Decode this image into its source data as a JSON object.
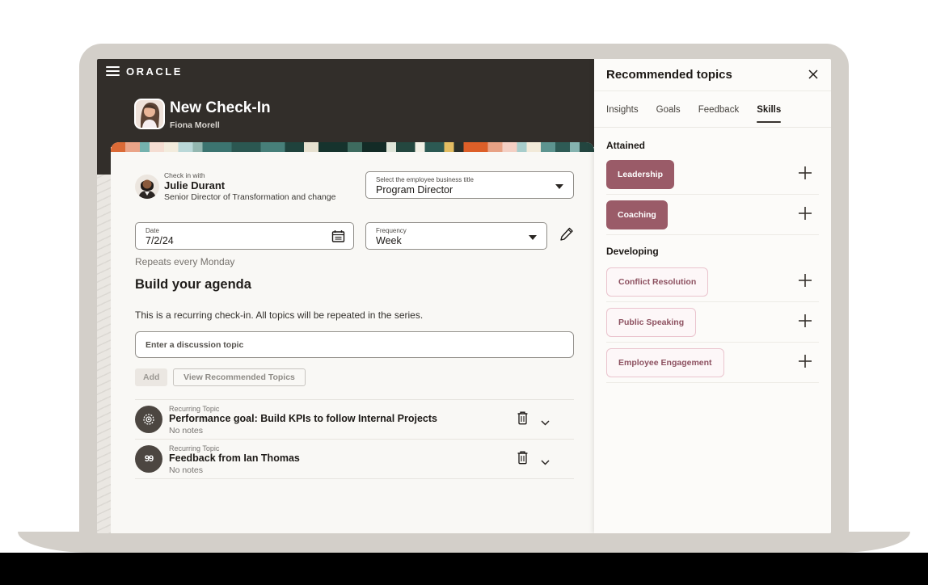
{
  "brand": {
    "logo": "ORACLE"
  },
  "header": {
    "title": "New Check-In",
    "subtitle": "Fiona Morell"
  },
  "checkin": {
    "with_label": "Check in with",
    "person_name": "Julie Durant",
    "person_title": "Senior Director of Transformation and change",
    "business_title_label": "Select the employee business title",
    "business_title_value": "Program Director",
    "date_label": "Date",
    "date_value": "7/2/24",
    "frequency_label": "Frequency",
    "frequency_value": "Week",
    "repeats_text": "Repeats every Monday"
  },
  "agenda": {
    "heading": "Build your agenda",
    "description": "This is a recurring check-in. All topics will be repeated in the series.",
    "topic_placeholder": "Enter a discussion topic",
    "add_label": "Add",
    "view_recommended_label": "View Recommended Topics",
    "topics": [
      {
        "type_label": "Recurring Topic",
        "title": "Performance goal: Build KPIs to follow Internal Projects",
        "notes": "No notes",
        "icon": "target-icon"
      },
      {
        "type_label": "Recurring Topic",
        "title": "Feedback from Ian Thomas",
        "notes": "No notes",
        "icon": "quote-icon",
        "quote_glyph": "99"
      }
    ]
  },
  "panel": {
    "title": "Recommended topics",
    "tabs": [
      {
        "label": "Insights",
        "active": false
      },
      {
        "label": "Goals",
        "active": false
      },
      {
        "label": "Feedback",
        "active": false
      },
      {
        "label": "Skills",
        "active": true
      }
    ],
    "sections": [
      {
        "heading": "Attained",
        "chips": [
          {
            "label": "Leadership",
            "style": "filled"
          },
          {
            "label": "Coaching",
            "style": "filled"
          }
        ]
      },
      {
        "heading": "Developing",
        "chips": [
          {
            "label": "Conflict Resolution",
            "style": "outlined"
          },
          {
            "label": "Public Speaking",
            "style": "outlined"
          },
          {
            "label": "Employee Engagement",
            "style": "outlined"
          }
        ]
      }
    ]
  },
  "colors": {
    "header_bg": "#322e2a",
    "chip_filled_bg": "#9a5b68",
    "chip_outlined_border": "#eac4ce",
    "chip_outlined_text": "#8d5160",
    "tab_active_underline": "#37332e",
    "frame": "#d3cfc9"
  }
}
